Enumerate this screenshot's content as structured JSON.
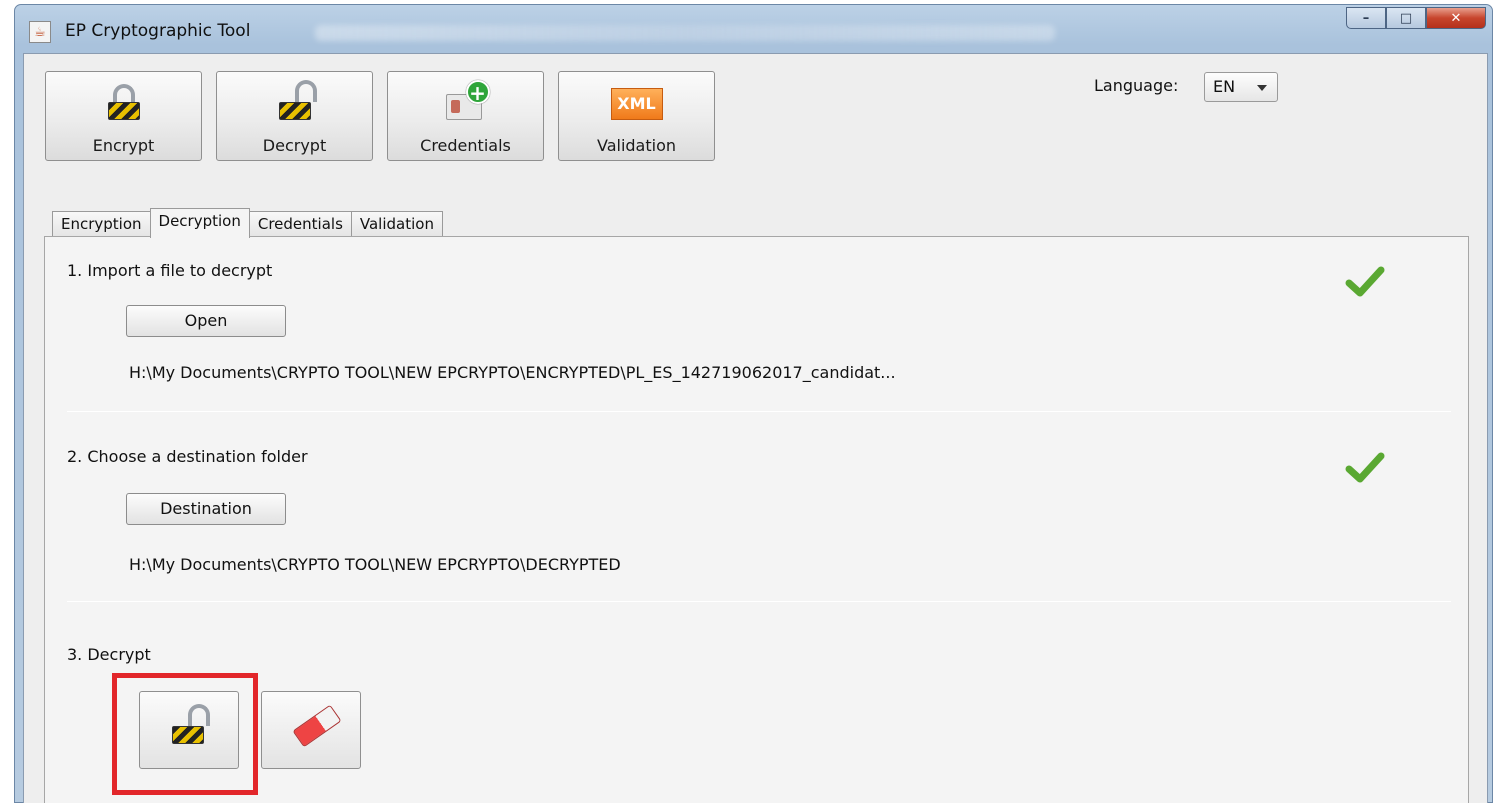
{
  "window": {
    "title": "EP Cryptographic Tool",
    "controls": {
      "minimize": "–",
      "maximize": "□",
      "close": "✕"
    }
  },
  "toolbar": {
    "encrypt_label": "Encrypt",
    "decrypt_label": "Decrypt",
    "credentials_label": "Credentials",
    "validation_label": "Validation",
    "xml_badge": "XML"
  },
  "language": {
    "label": "Language:",
    "selected": "EN"
  },
  "tabs": [
    {
      "label": "Encryption"
    },
    {
      "label": "Decryption"
    },
    {
      "label": "Credentials"
    },
    {
      "label": "Validation"
    }
  ],
  "decryption": {
    "step1": {
      "title": "1. Import a file to decrypt",
      "button": "Open",
      "path": "H:\\My Documents\\CRYPTO TOOL\\NEW EPCRYPTO\\ENCRYPTED\\PL_ES_142719062017_candidat..."
    },
    "step2": {
      "title": "2. Choose a destination folder",
      "button": "Destination",
      "path": "H:\\My Documents\\CRYPTO TOOL\\NEW EPCRYPTO\\DECRYPTED"
    },
    "step3": {
      "title": "3. Decrypt"
    }
  },
  "colors": {
    "highlight": "#e2262a",
    "check": "#5aa832",
    "xml": "#f07a1a"
  }
}
